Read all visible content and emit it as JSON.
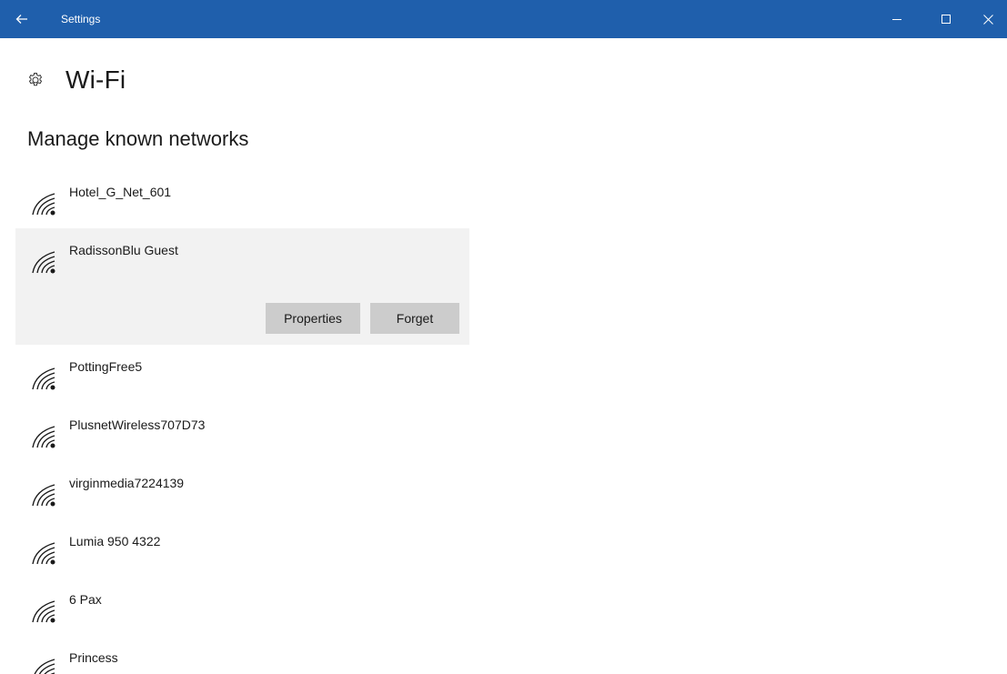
{
  "titlebar": {
    "title": "Settings",
    "back_icon": "back-arrow-icon",
    "controls": [
      "minimize-icon",
      "maximize-icon",
      "close-icon"
    ],
    "color": "#1f5fac"
  },
  "header": {
    "icon": "gear-icon",
    "title": "Wi-Fi"
  },
  "section": {
    "title": "Manage known networks"
  },
  "networks": [
    {
      "name": "Hotel_G_Net_601"
    },
    {
      "name": "RadissonBlu Guest",
      "expanded": true
    },
    {
      "name": "PottingFree5"
    },
    {
      "name": "PlusnetWireless707D73"
    },
    {
      "name": "virginmedia7224139"
    },
    {
      "name": "Lumia 950 4322"
    },
    {
      "name": "6 Pax"
    },
    {
      "name": "Princess"
    }
  ],
  "expanded_actions": {
    "properties_label": "Properties",
    "forget_label": "Forget",
    "button_color": "#cccccc",
    "row_highlight_color": "#f2f2f2"
  }
}
